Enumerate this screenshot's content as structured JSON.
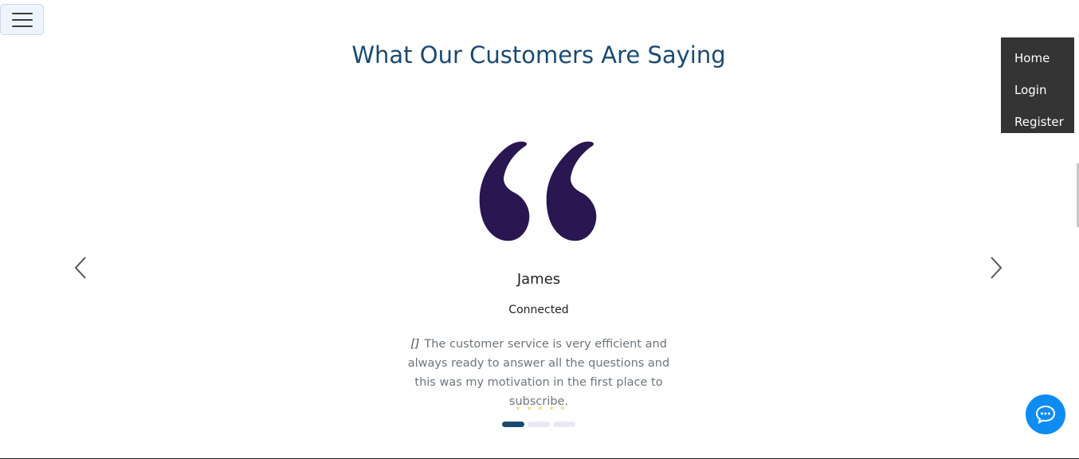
{
  "nav": {
    "toggle_icon": "hamburger-icon",
    "items": [
      {
        "label": "Home"
      },
      {
        "label": "Login"
      },
      {
        "label": "Register"
      }
    ]
  },
  "section": {
    "title": "What Our Customers Are Saying"
  },
  "carousel": {
    "quote_icon": "quote-icon",
    "prev_icon": "chevron-left-icon",
    "next_icon": "chevron-right-icon",
    "active_slide": 1,
    "slide_count": 3,
    "testimonial": {
      "name": "James",
      "status": "Connected",
      "text": "The customer service is very efficient and always ready to answer all the questions and this was my motivation in the first place to subscribe.",
      "inline_quote_glyph": "[]",
      "rating": 5,
      "star_glyph": "*"
    }
  },
  "chat": {
    "icon": "chat-bubble-icon",
    "color": "#0d8cf2"
  },
  "colors": {
    "heading": "#1b4a70",
    "quote_mark": "#2a1650",
    "indicator_active": "#1b4a70",
    "indicator_inactive": "#ece7f4",
    "star": "#f0c419",
    "nav_bg": "#343434"
  }
}
